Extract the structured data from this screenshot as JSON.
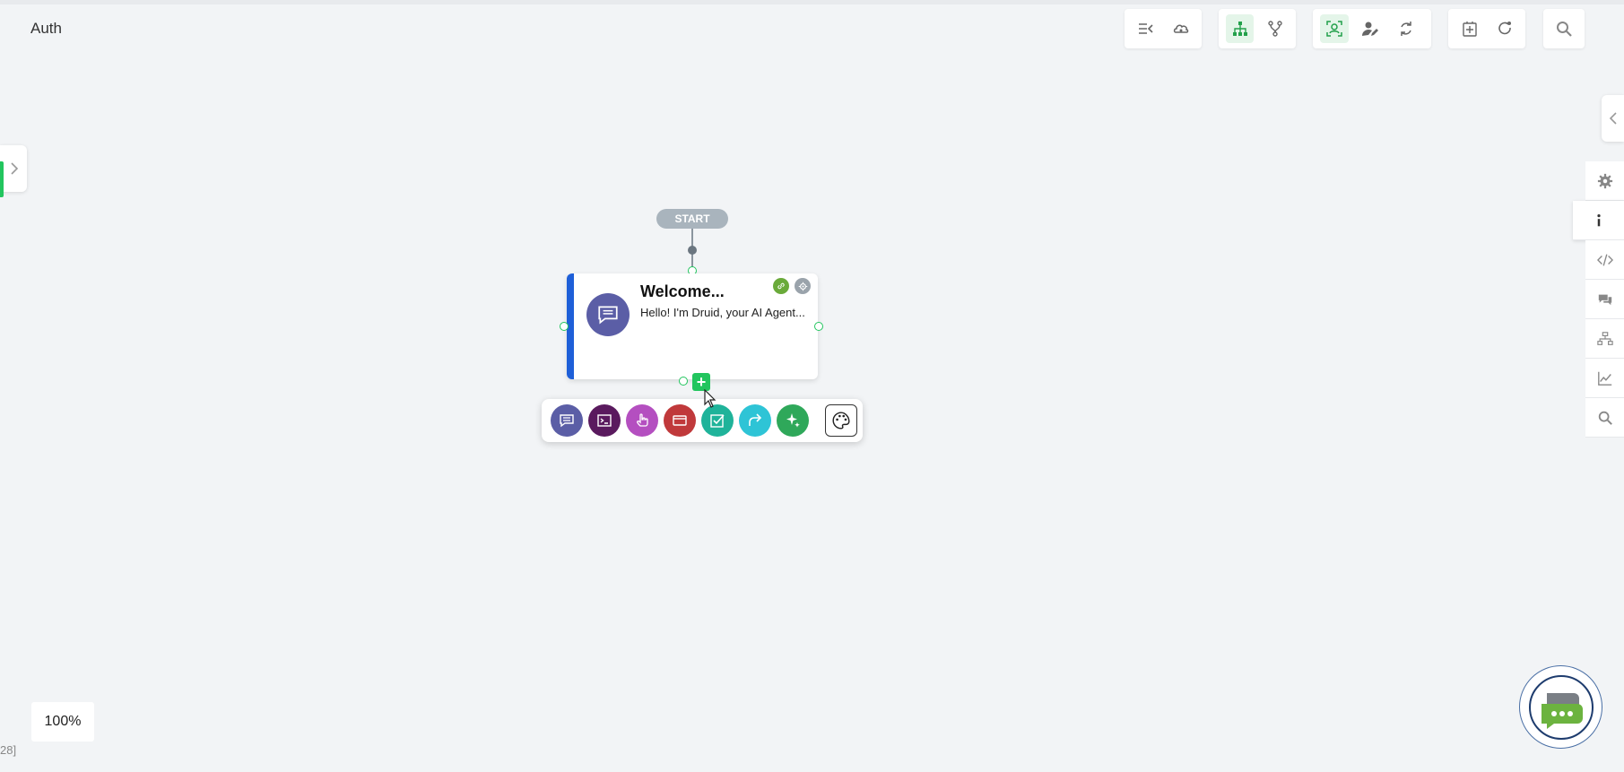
{
  "header": {
    "title": "Auth"
  },
  "toolbar": {
    "groups": [
      [
        "collapse-list-icon",
        "cloud-brain-icon"
      ],
      [
        "flow-tree-icon",
        "branch-icon"
      ],
      [
        "ai-agent-icon",
        "user-edit-icon",
        "refresh-icon"
      ],
      [
        "add-flow-icon",
        "reload-icon"
      ],
      [
        "search-icon"
      ]
    ]
  },
  "right_rail": [
    "settings-icon",
    "info-icon",
    "code-icon",
    "chat-icon",
    "integrations-icon",
    "analytics-icon",
    "search-icon"
  ],
  "canvas": {
    "start_label": "START",
    "node": {
      "title": "Welcome...",
      "subtitle": "Hello! I'm Druid, your AI Agent...",
      "accent_color": "#1e5fd8"
    },
    "palette": [
      {
        "icon": "message-icon",
        "color": "#5b5ea6"
      },
      {
        "icon": "terminal-icon",
        "color": "#5a1a5e"
      },
      {
        "icon": "hand-pointer-icon",
        "color": "#b44fc0"
      },
      {
        "icon": "card-icon",
        "color": "#c0393b"
      },
      {
        "icon": "checkbox-icon",
        "color": "#1fb39a"
      },
      {
        "icon": "redirect-arrow-icon",
        "color": "#2ec4d6"
      },
      {
        "icon": "sparkles-icon",
        "color": "#2fa85a"
      }
    ]
  },
  "zoom": {
    "level": "100%"
  },
  "corner_text": "28]",
  "colors": {
    "accent_green": "#22c55e",
    "canvas_bg": "#f2f4f6"
  }
}
